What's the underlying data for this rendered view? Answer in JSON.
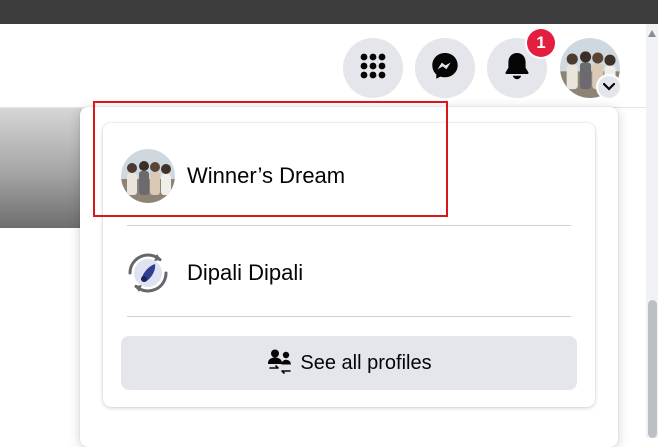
{
  "header": {
    "menu_icon": "grid-menu-icon",
    "messenger_icon": "messenger-icon",
    "notifications_icon": "bell-icon",
    "notification_count": "1",
    "account_caret_icon": "chevron-down-icon"
  },
  "profiles_menu": {
    "profiles": [
      {
        "name": "Winner’s Dream",
        "avatar": "group-photo-avatar"
      },
      {
        "name": "Dipali Dipali",
        "avatar": "switch-profile-avatar"
      }
    ],
    "see_all_label": "See all profiles",
    "see_all_icon": "profiles-switch-icon"
  },
  "colors": {
    "button_bg": "#e4e6eb",
    "badge": "#e41e3f",
    "highlight_box": "#d9171b",
    "text": "#050505"
  }
}
